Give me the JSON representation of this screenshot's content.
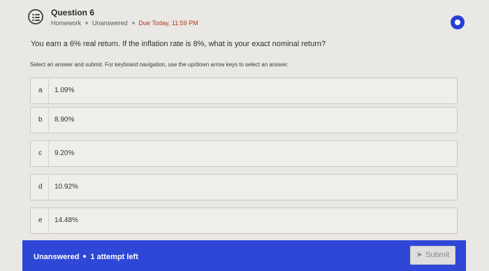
{
  "question": {
    "title": "Question 6",
    "meta": {
      "type": "Homework",
      "status": "Unanswered",
      "due": "Due Today, 11:59 PM"
    },
    "text": "You earn a 6% real return.  If the inflation rate is 8%, what is your exact nominal return?",
    "instructions": "Select an answer and submit. For keyboard navigation, use the up/down arrow keys to select an answer.",
    "icons": {
      "question_type": "multiple-choice-list-icon",
      "bookmark": "bookmark-circle-icon"
    }
  },
  "choices": [
    {
      "letter": "a",
      "value": "1.09%"
    },
    {
      "letter": "b",
      "value": "8.90%"
    },
    {
      "letter": "c",
      "value": "9.20%"
    },
    {
      "letter": "d",
      "value": "10.92%"
    },
    {
      "letter": "e",
      "value": "14.48%"
    }
  ],
  "footer": {
    "status": "Unanswered",
    "attempts": "1 attempt left",
    "submit_label": "Submit",
    "submit_icon": "paper-plane-icon",
    "color": "#2f47d6"
  }
}
